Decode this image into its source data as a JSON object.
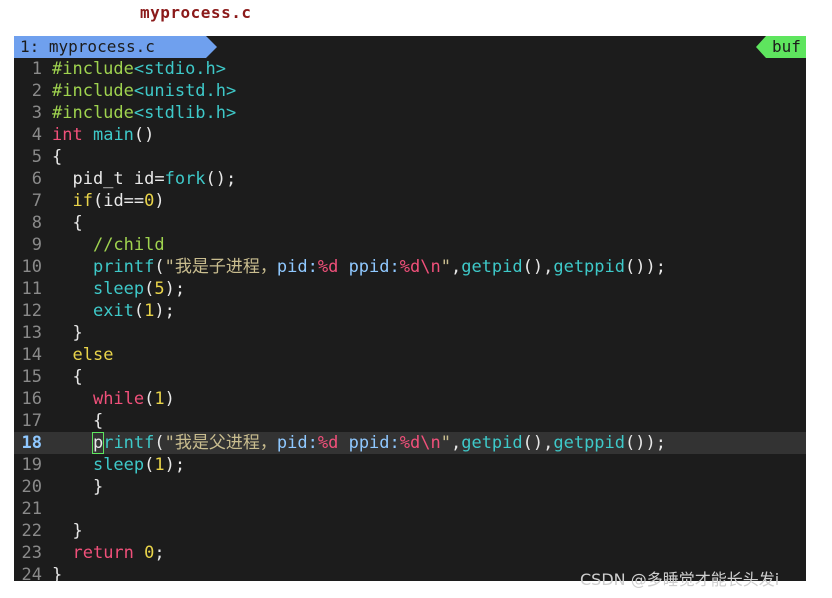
{
  "caption": {
    "filename": "myprocess.c"
  },
  "tabline": {
    "active_tab": "1: myprocess.c",
    "right_label": "buf"
  },
  "editor": {
    "cursor_line": 18,
    "lines": [
      {
        "n": "1",
        "tokens": [
          {
            "t": "#include",
            "c": "pre"
          },
          {
            "t": "<stdio.h>",
            "c": "inc"
          }
        ]
      },
      {
        "n": "2",
        "tokens": [
          {
            "t": "#include",
            "c": "pre"
          },
          {
            "t": "<unistd.h>",
            "c": "inc"
          }
        ]
      },
      {
        "n": "3",
        "tokens": [
          {
            "t": "#include",
            "c": "pre"
          },
          {
            "t": "<stdlib.h>",
            "c": "inc"
          }
        ]
      },
      {
        "n": "4",
        "tokens": [
          {
            "t": "int",
            "c": "type"
          },
          {
            "t": " ",
            "c": "plain"
          },
          {
            "t": "main",
            "c": "fn"
          },
          {
            "t": "()",
            "c": "plain"
          }
        ]
      },
      {
        "n": "5",
        "tokens": [
          {
            "t": "{",
            "c": "plain"
          }
        ]
      },
      {
        "n": "6",
        "tokens": [
          {
            "t": "  pid_t id=",
            "c": "plain"
          },
          {
            "t": "fork",
            "c": "fn"
          },
          {
            "t": "();",
            "c": "plain"
          }
        ]
      },
      {
        "n": "7",
        "tokens": [
          {
            "t": "  ",
            "c": "plain"
          },
          {
            "t": "if",
            "c": "kw"
          },
          {
            "t": "(id==",
            "c": "plain"
          },
          {
            "t": "0",
            "c": "num"
          },
          {
            "t": ")",
            "c": "plain"
          }
        ]
      },
      {
        "n": "8",
        "tokens": [
          {
            "t": "  {",
            "c": "plain"
          }
        ]
      },
      {
        "n": "9",
        "tokens": [
          {
            "t": "    ",
            "c": "plain"
          },
          {
            "t": "//child",
            "c": "cmt"
          }
        ]
      },
      {
        "n": "10",
        "tokens": [
          {
            "t": "    ",
            "c": "plain"
          },
          {
            "t": "printf",
            "c": "fn"
          },
          {
            "t": "(",
            "c": "plain"
          },
          {
            "t": "\"我是子进程，",
            "c": "str"
          },
          {
            "t": "pid:",
            "c": "spec"
          },
          {
            "t": "%d",
            "c": "fmt"
          },
          {
            "t": " ",
            "c": "str"
          },
          {
            "t": "ppid:",
            "c": "spec"
          },
          {
            "t": "%d\\n",
            "c": "fmt"
          },
          {
            "t": "\"",
            "c": "str"
          },
          {
            "t": ",",
            "c": "plain"
          },
          {
            "t": "getpid",
            "c": "fn"
          },
          {
            "t": "(),",
            "c": "plain"
          },
          {
            "t": "getppid",
            "c": "fn"
          },
          {
            "t": "());",
            "c": "plain"
          }
        ]
      },
      {
        "n": "11",
        "tokens": [
          {
            "t": "    ",
            "c": "plain"
          },
          {
            "t": "sleep",
            "c": "fn"
          },
          {
            "t": "(",
            "c": "plain"
          },
          {
            "t": "5",
            "c": "num"
          },
          {
            "t": ");",
            "c": "plain"
          }
        ]
      },
      {
        "n": "12",
        "tokens": [
          {
            "t": "    ",
            "c": "plain"
          },
          {
            "t": "exit",
            "c": "fn"
          },
          {
            "t": "(",
            "c": "plain"
          },
          {
            "t": "1",
            "c": "num"
          },
          {
            "t": ");",
            "c": "plain"
          }
        ]
      },
      {
        "n": "13",
        "tokens": [
          {
            "t": "  }",
            "c": "plain"
          }
        ]
      },
      {
        "n": "14",
        "tokens": [
          {
            "t": "  ",
            "c": "plain"
          },
          {
            "t": "else",
            "c": "kw"
          }
        ]
      },
      {
        "n": "15",
        "tokens": [
          {
            "t": "  {",
            "c": "plain"
          }
        ]
      },
      {
        "n": "16",
        "tokens": [
          {
            "t": "    ",
            "c": "plain"
          },
          {
            "t": "while",
            "c": "pink"
          },
          {
            "t": "(",
            "c": "plain"
          },
          {
            "t": "1",
            "c": "num"
          },
          {
            "t": ")",
            "c": "plain"
          }
        ]
      },
      {
        "n": "17",
        "tokens": [
          {
            "t": "    {",
            "c": "plain"
          }
        ]
      },
      {
        "n": "18",
        "tokens": [
          {
            "t": "    ",
            "c": "plain"
          },
          {
            "t": "p",
            "c": "cursor"
          },
          {
            "t": "rintf",
            "c": "fn"
          },
          {
            "t": "(",
            "c": "plain"
          },
          {
            "t": "\"我是父进程，",
            "c": "str"
          },
          {
            "t": "pid:",
            "c": "spec"
          },
          {
            "t": "%d",
            "c": "fmt"
          },
          {
            "t": " ",
            "c": "str"
          },
          {
            "t": "ppid:",
            "c": "spec"
          },
          {
            "t": "%d\\n",
            "c": "fmt"
          },
          {
            "t": "\"",
            "c": "str"
          },
          {
            "t": ",",
            "c": "plain"
          },
          {
            "t": "getpid",
            "c": "fn"
          },
          {
            "t": "(),",
            "c": "plain"
          },
          {
            "t": "getppid",
            "c": "fn"
          },
          {
            "t": "());",
            "c": "plain"
          }
        ]
      },
      {
        "n": "19",
        "tokens": [
          {
            "t": "    ",
            "c": "plain"
          },
          {
            "t": "sleep",
            "c": "fn"
          },
          {
            "t": "(",
            "c": "plain"
          },
          {
            "t": "1",
            "c": "num"
          },
          {
            "t": ");",
            "c": "plain"
          }
        ]
      },
      {
        "n": "20",
        "tokens": [
          {
            "t": "    }",
            "c": "plain"
          }
        ]
      },
      {
        "n": "21",
        "tokens": []
      },
      {
        "n": "22",
        "tokens": [
          {
            "t": "  }",
            "c": "plain"
          }
        ]
      },
      {
        "n": "23",
        "tokens": [
          {
            "t": "  ",
            "c": "plain"
          },
          {
            "t": "return",
            "c": "type"
          },
          {
            "t": " ",
            "c": "plain"
          },
          {
            "t": "0",
            "c": "num"
          },
          {
            "t": ";",
            "c": "plain"
          }
        ]
      },
      {
        "n": "24",
        "tokens": [
          {
            "t": "}",
            "c": "plain"
          }
        ]
      }
    ]
  },
  "watermark": "CSDN @多睡觉才能长头发i"
}
